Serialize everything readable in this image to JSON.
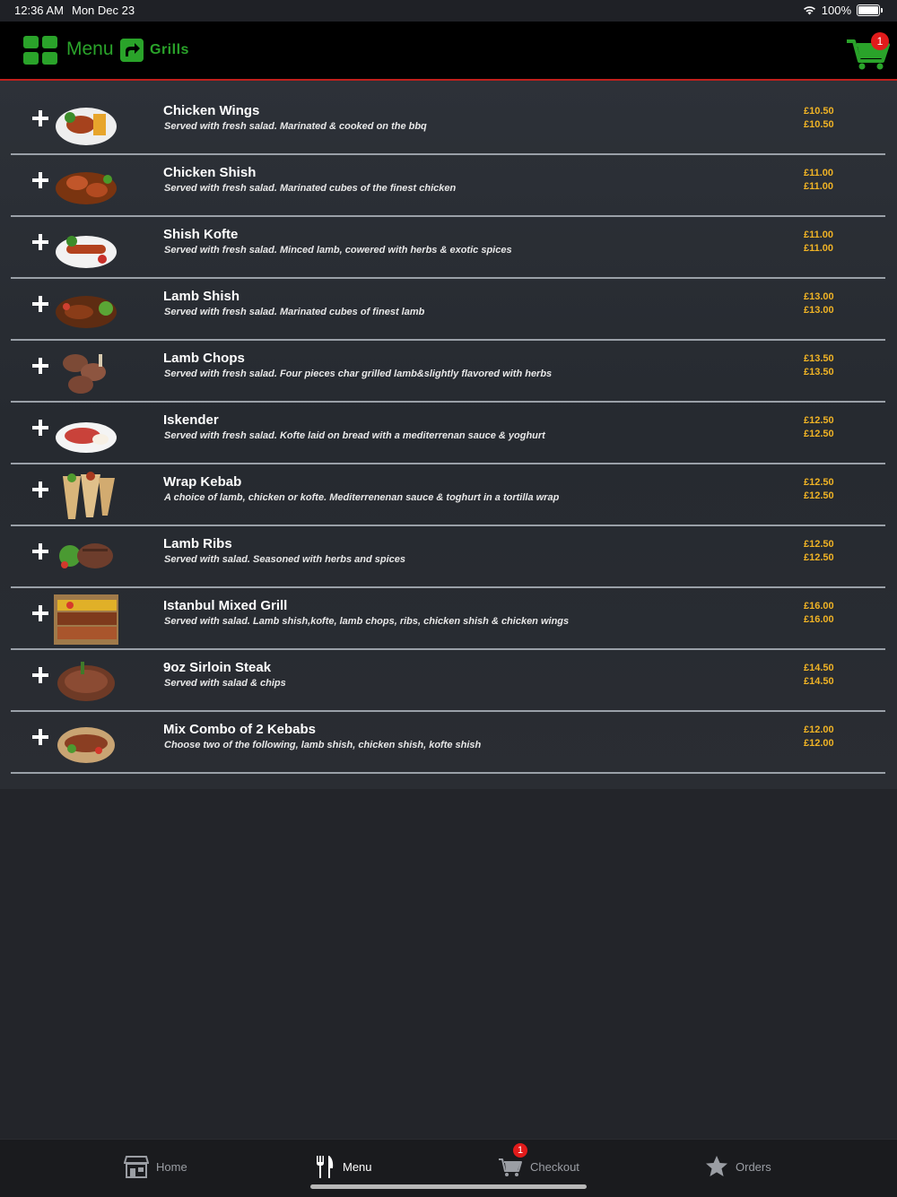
{
  "status": {
    "time": "12:36 AM",
    "date": "Mon Dec 23",
    "battery": "100%"
  },
  "header": {
    "menu_label": "Menu",
    "category_label": "Grills",
    "cart_count": "1"
  },
  "colors": {
    "brand_green": "#2aa32a",
    "price_gold": "#f0b325",
    "accent_red": "#c0201d",
    "badge_red": "#e21b1b"
  },
  "items": [
    {
      "name": "Chicken Wings",
      "desc": "Served with fresh salad. Marinated & cooked on the bbq",
      "price1": "£10.50",
      "price2": "£10.50",
      "image": "chicken-wings-photo"
    },
    {
      "name": "Chicken Shish",
      "desc": "Served with fresh salad. Marinated cubes of the finest chicken",
      "price1": "£11.00",
      "price2": "£11.00",
      "image": "chicken-shish-photo"
    },
    {
      "name": "Shish Kofte",
      "desc": "Served with fresh salad. Minced lamb, cowered with herbs & exotic spices",
      "price1": "£11.00",
      "price2": "£11.00",
      "image": "shish-kofte-photo"
    },
    {
      "name": "Lamb Shish",
      "desc": "Served with fresh salad. Marinated cubes of finest lamb",
      "price1": "£13.00",
      "price2": "£13.00",
      "image": "lamb-shish-photo"
    },
    {
      "name": "Lamb Chops",
      "desc": "Served with fresh salad. Four pieces char grilled lamb&slightly flavored with herbs",
      "price1": "£13.50",
      "price2": "£13.50",
      "image": "lamb-chops-photo"
    },
    {
      "name": "Iskender",
      "desc": "Served with fresh salad. Kofte laid on bread with a mediterrenan sauce & yoghurt",
      "price1": "£12.50",
      "price2": "£12.50",
      "image": "iskender-photo"
    },
    {
      "name": "Wrap Kebab",
      "desc": "A choice of lamb, chicken or kofte. Mediterrenenan sauce & toghurt in a tortilla wrap",
      "price1": "£12.50",
      "price2": "£12.50",
      "image": "wrap-kebab-photo"
    },
    {
      "name": "Lamb Ribs",
      "desc": "Served with salad. Seasoned with herbs and spices",
      "price1": "£12.50",
      "price2": "£12.50",
      "image": "lamb-ribs-photo"
    },
    {
      "name": "Istanbul Mixed Grill",
      "desc": "Served with salad. Lamb shish,kofte, lamb chops, ribs, chicken shish & chicken wings",
      "price1": "£16.00",
      "price2": "£16.00",
      "image": "mixed-grill-photo"
    },
    {
      "name": "9oz Sirloin Steak",
      "desc": "Served with salad & chips",
      "price1": "£14.50",
      "price2": "£14.50",
      "image": "sirloin-steak-photo"
    },
    {
      "name": "Mix Combo of 2 Kebabs",
      "desc": "Choose two of the following, lamb shish, chicken shish, kofte shish",
      "price1": "£12.00",
      "price2": "£12.00",
      "image": "combo-kebab-photo"
    }
  ],
  "tabbar": {
    "home": "Home",
    "menu": "Menu",
    "checkout": "Checkout",
    "checkout_badge": "1",
    "orders": "Orders",
    "active": "menu"
  }
}
